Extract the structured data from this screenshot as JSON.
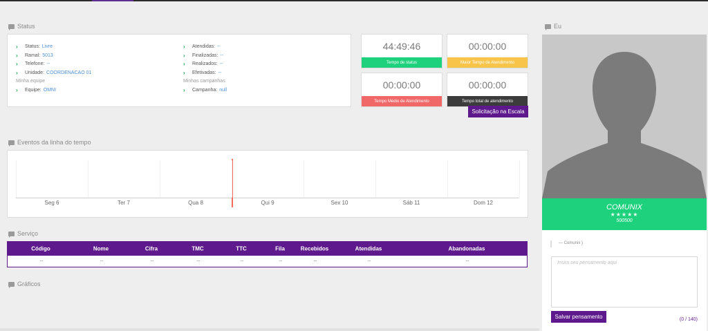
{
  "status_section": {
    "title": "Status",
    "left": [
      {
        "label": "Status:",
        "value": "Livre"
      },
      {
        "label": "Ramal:",
        "value": "5013"
      },
      {
        "label": "Telefone:",
        "value": "--"
      },
      {
        "label": "Unidade:",
        "value": "COORDENACAO 01"
      }
    ],
    "left_group_title": "Minha equipe",
    "left_group_item": {
      "label": "Equipe:",
      "value": "OMNI"
    },
    "right": [
      {
        "label": "Atendidas:",
        "value": "--"
      },
      {
        "label": "Finalizadas:",
        "value": "--"
      },
      {
        "label": "Realizados:",
        "value": "--"
      },
      {
        "label": "Efetivadas:",
        "value": "--"
      }
    ],
    "right_group_title": "Minhas campanhas",
    "right_group_item": {
      "label": "Campanha:",
      "value": "null"
    }
  },
  "timers": [
    {
      "time": "44:49:46",
      "label": "Tempo de status",
      "color": "#1dd17d"
    },
    {
      "time": "00:00:00",
      "label": "Maior Tempo de Atendimento",
      "color": "#f8c54a"
    },
    {
      "time": "00:00:00",
      "label": "Tempo Médio de Atendimento",
      "color": "#f06868"
    },
    {
      "time": "00:00:00",
      "label": "Tempo total de atendimento",
      "color": "#3c3c3c"
    }
  ],
  "schedule_button": "Solicitação na Escala",
  "timeline": {
    "title": "Eventos da linha do tempo",
    "days": [
      "Seg 6",
      "Ter 7",
      "Qua 8",
      "Qui 9",
      "Sex 10",
      "Sáb 11",
      "Dom 12"
    ],
    "marker_color": "#f26b5b"
  },
  "service": {
    "title": "Serviço",
    "columns": [
      "Código",
      "Nome",
      "Cifra",
      "TMC",
      "TTC",
      "Fila",
      "Recebidos",
      "Atendidas",
      "Abandonadas"
    ],
    "row": [
      "--",
      "--",
      "--",
      "--",
      "--",
      "--",
      "--",
      "--",
      "--"
    ]
  },
  "charts_title": "Gráficos",
  "profile": {
    "title": "Eu",
    "name": "COMUNIX",
    "rating": "★★★★★",
    "code": "500500",
    "quote": "— Comunix )",
    "textarea_placeholder": "Insira seu pensamento aqui",
    "save_button": "Salvar pensamento",
    "counter": "(0 / 140)",
    "accent": "#1dd17d"
  }
}
